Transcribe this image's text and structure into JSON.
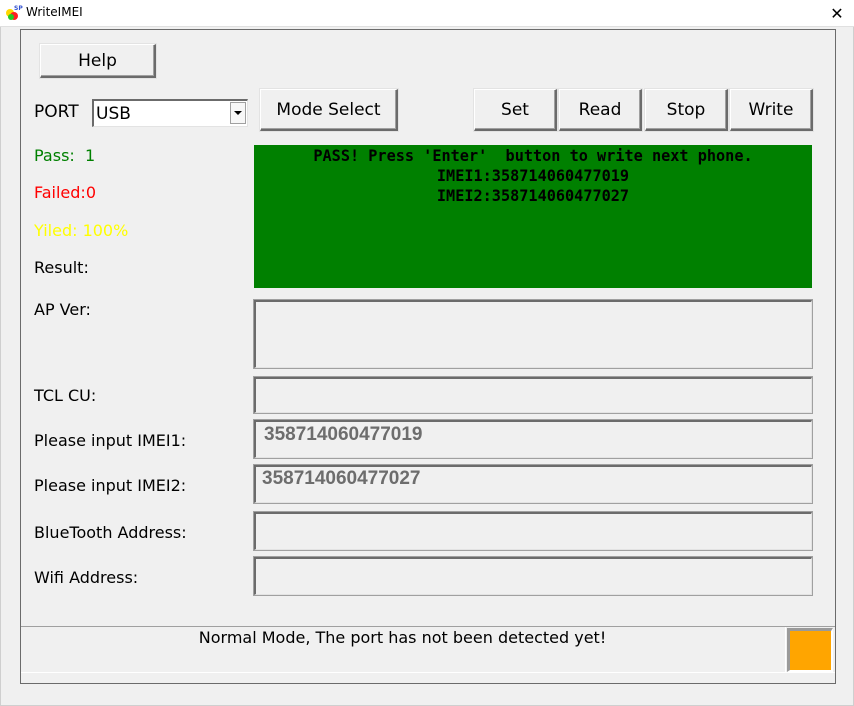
{
  "window": {
    "title": "WriteIMEI",
    "icon": "app-logo-icon",
    "close_icon": "close-icon",
    "close_glyph": "✕"
  },
  "toolbar": {
    "help_label": "Help",
    "port_label": "PORT",
    "port_value": "USB",
    "mode_select_label": "Mode Select",
    "set_label": "Set",
    "read_label": "Read",
    "stop_label": "Stop",
    "write_label": "Write"
  },
  "stats": {
    "pass_label": "Pass:  1",
    "failed_label": "Failed:0",
    "yield_label": "Yiled: 100%",
    "result_label": "Result:",
    "colors": {
      "pass": "#008000",
      "failed": "#ff0000",
      "yield": "#ffff00"
    }
  },
  "result": {
    "background": "#008000",
    "lines": [
      "PASS! Press 'Enter'  button to write next phone.",
      "IMEI1:358714060477019",
      "IMEI2:358714060477027"
    ]
  },
  "fields": {
    "ap_ver": {
      "label": "AP Ver:",
      "value": ""
    },
    "tcl_cu": {
      "label": "TCL CU:",
      "value": ""
    },
    "imei1": {
      "label": "Please input IMEI1:",
      "value": "358714060477019"
    },
    "imei2": {
      "label": "Please input IMEI2:",
      "value": "358714060477027"
    },
    "bluetooth": {
      "label": "BlueTooth Address:",
      "value": ""
    },
    "wifi": {
      "label": "Wifi Address:",
      "value": ""
    }
  },
  "status": {
    "message": "Normal Mode, The port has not been detected yet!",
    "indicator_color": "#ffa500"
  }
}
